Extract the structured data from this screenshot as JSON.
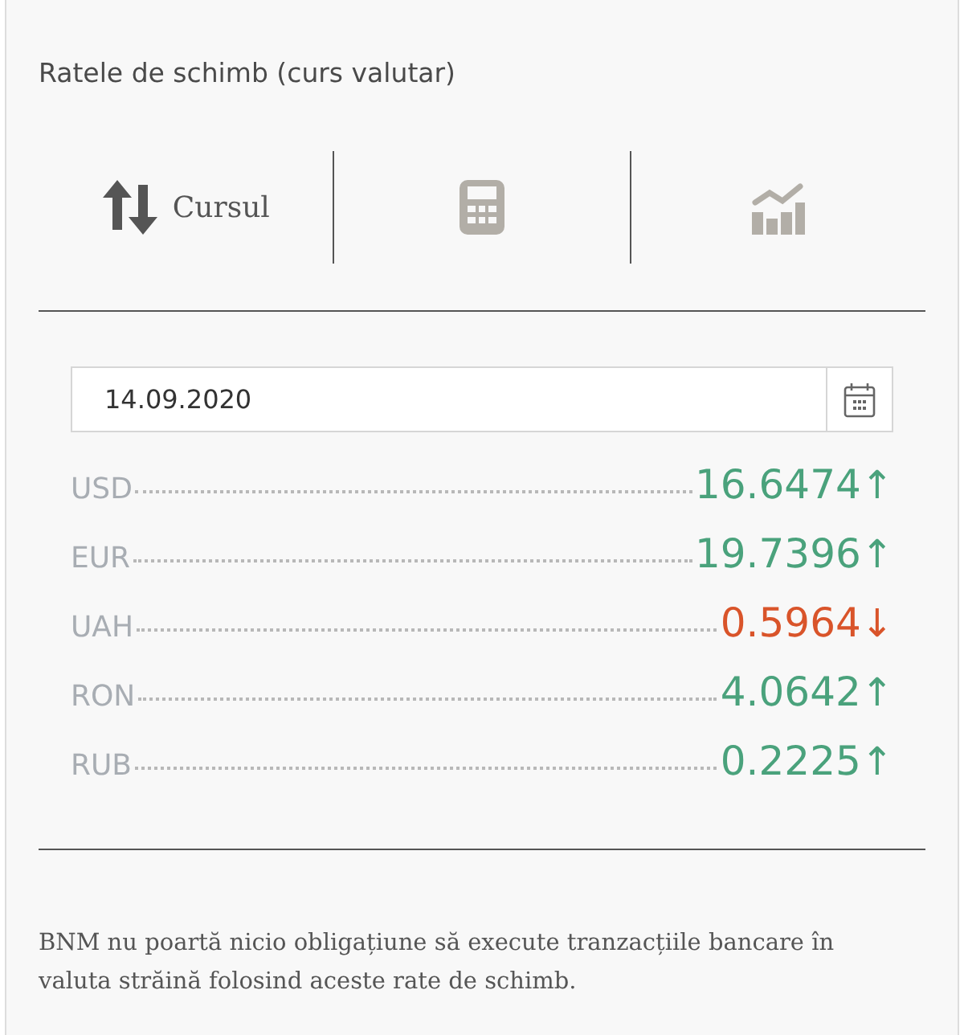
{
  "title": "Ratele de schimb (curs valutar)",
  "tabs": [
    {
      "kind": "rates",
      "label": "Cursul",
      "selected": true
    },
    {
      "kind": "calculator",
      "selected": false
    },
    {
      "kind": "chart",
      "selected": false
    }
  ],
  "date_field": {
    "value": "14.09.2020"
  },
  "rates": [
    {
      "code": "USD",
      "value": "16.6474",
      "arrow": "↑",
      "rising": true
    },
    {
      "code": "EUR",
      "value": "19.7396",
      "arrow": "↑",
      "rising": true
    },
    {
      "code": "UAH",
      "value": "0.5964",
      "arrow": "↓",
      "rising": false
    },
    {
      "code": "RON",
      "value": "4.0642",
      "arrow": "↑",
      "rising": true
    },
    {
      "code": "RUB",
      "value": "0.2225",
      "arrow": "↑",
      "rising": true
    }
  ],
  "disclaimer": "BNM nu poartă nicio obligațiune să execute tranzacțiile bancare în valuta străină folosind aceste rate de schimb."
}
